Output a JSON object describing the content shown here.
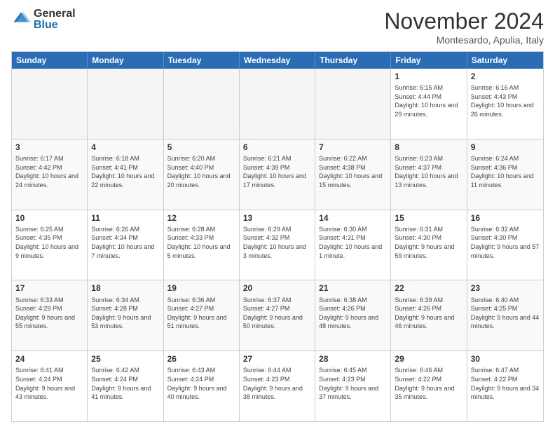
{
  "logo": {
    "general": "General",
    "blue": "Blue"
  },
  "title": "November 2024",
  "location": "Montesardo, Apulia, Italy",
  "days_of_week": [
    "Sunday",
    "Monday",
    "Tuesday",
    "Wednesday",
    "Thursday",
    "Friday",
    "Saturday"
  ],
  "weeks": [
    [
      {
        "day": "",
        "empty": true
      },
      {
        "day": "",
        "empty": true
      },
      {
        "day": "",
        "empty": true
      },
      {
        "day": "",
        "empty": true
      },
      {
        "day": "",
        "empty": true
      },
      {
        "day": "1",
        "sunrise": "Sunrise: 6:15 AM",
        "sunset": "Sunset: 4:44 PM",
        "daylight": "Daylight: 10 hours and 29 minutes."
      },
      {
        "day": "2",
        "sunrise": "Sunrise: 6:16 AM",
        "sunset": "Sunset: 4:43 PM",
        "daylight": "Daylight: 10 hours and 26 minutes."
      }
    ],
    [
      {
        "day": "3",
        "sunrise": "Sunrise: 6:17 AM",
        "sunset": "Sunset: 4:42 PM",
        "daylight": "Daylight: 10 hours and 24 minutes."
      },
      {
        "day": "4",
        "sunrise": "Sunrise: 6:18 AM",
        "sunset": "Sunset: 4:41 PM",
        "daylight": "Daylight: 10 hours and 22 minutes."
      },
      {
        "day": "5",
        "sunrise": "Sunrise: 6:20 AM",
        "sunset": "Sunset: 4:40 PM",
        "daylight": "Daylight: 10 hours and 20 minutes."
      },
      {
        "day": "6",
        "sunrise": "Sunrise: 6:21 AM",
        "sunset": "Sunset: 4:39 PM",
        "daylight": "Daylight: 10 hours and 17 minutes."
      },
      {
        "day": "7",
        "sunrise": "Sunrise: 6:22 AM",
        "sunset": "Sunset: 4:38 PM",
        "daylight": "Daylight: 10 hours and 15 minutes."
      },
      {
        "day": "8",
        "sunrise": "Sunrise: 6:23 AM",
        "sunset": "Sunset: 4:37 PM",
        "daylight": "Daylight: 10 hours and 13 minutes."
      },
      {
        "day": "9",
        "sunrise": "Sunrise: 6:24 AM",
        "sunset": "Sunset: 4:36 PM",
        "daylight": "Daylight: 10 hours and 11 minutes."
      }
    ],
    [
      {
        "day": "10",
        "sunrise": "Sunrise: 6:25 AM",
        "sunset": "Sunset: 4:35 PM",
        "daylight": "Daylight: 10 hours and 9 minutes."
      },
      {
        "day": "11",
        "sunrise": "Sunrise: 6:26 AM",
        "sunset": "Sunset: 4:34 PM",
        "daylight": "Daylight: 10 hours and 7 minutes."
      },
      {
        "day": "12",
        "sunrise": "Sunrise: 6:28 AM",
        "sunset": "Sunset: 4:33 PM",
        "daylight": "Daylight: 10 hours and 5 minutes."
      },
      {
        "day": "13",
        "sunrise": "Sunrise: 6:29 AM",
        "sunset": "Sunset: 4:32 PM",
        "daylight": "Daylight: 10 hours and 3 minutes."
      },
      {
        "day": "14",
        "sunrise": "Sunrise: 6:30 AM",
        "sunset": "Sunset: 4:31 PM",
        "daylight": "Daylight: 10 hours and 1 minute."
      },
      {
        "day": "15",
        "sunrise": "Sunrise: 6:31 AM",
        "sunset": "Sunset: 4:30 PM",
        "daylight": "Daylight: 9 hours and 59 minutes."
      },
      {
        "day": "16",
        "sunrise": "Sunrise: 6:32 AM",
        "sunset": "Sunset: 4:30 PM",
        "daylight": "Daylight: 9 hours and 57 minutes."
      }
    ],
    [
      {
        "day": "17",
        "sunrise": "Sunrise: 6:33 AM",
        "sunset": "Sunset: 4:29 PM",
        "daylight": "Daylight: 9 hours and 55 minutes."
      },
      {
        "day": "18",
        "sunrise": "Sunrise: 6:34 AM",
        "sunset": "Sunset: 4:28 PM",
        "daylight": "Daylight: 9 hours and 53 minutes."
      },
      {
        "day": "19",
        "sunrise": "Sunrise: 6:36 AM",
        "sunset": "Sunset: 4:27 PM",
        "daylight": "Daylight: 9 hours and 51 minutes."
      },
      {
        "day": "20",
        "sunrise": "Sunrise: 6:37 AM",
        "sunset": "Sunset: 4:27 PM",
        "daylight": "Daylight: 9 hours and 50 minutes."
      },
      {
        "day": "21",
        "sunrise": "Sunrise: 6:38 AM",
        "sunset": "Sunset: 4:26 PM",
        "daylight": "Daylight: 9 hours and 48 minutes."
      },
      {
        "day": "22",
        "sunrise": "Sunrise: 6:39 AM",
        "sunset": "Sunset: 4:26 PM",
        "daylight": "Daylight: 9 hours and 46 minutes."
      },
      {
        "day": "23",
        "sunrise": "Sunrise: 6:40 AM",
        "sunset": "Sunset: 4:25 PM",
        "daylight": "Daylight: 9 hours and 44 minutes."
      }
    ],
    [
      {
        "day": "24",
        "sunrise": "Sunrise: 6:41 AM",
        "sunset": "Sunset: 4:24 PM",
        "daylight": "Daylight: 9 hours and 43 minutes."
      },
      {
        "day": "25",
        "sunrise": "Sunrise: 6:42 AM",
        "sunset": "Sunset: 4:24 PM",
        "daylight": "Daylight: 9 hours and 41 minutes."
      },
      {
        "day": "26",
        "sunrise": "Sunrise: 6:43 AM",
        "sunset": "Sunset: 4:24 PM",
        "daylight": "Daylight: 9 hours and 40 minutes."
      },
      {
        "day": "27",
        "sunrise": "Sunrise: 6:44 AM",
        "sunset": "Sunset: 4:23 PM",
        "daylight": "Daylight: 9 hours and 38 minutes."
      },
      {
        "day": "28",
        "sunrise": "Sunrise: 6:45 AM",
        "sunset": "Sunset: 4:23 PM",
        "daylight": "Daylight: 9 hours and 37 minutes."
      },
      {
        "day": "29",
        "sunrise": "Sunrise: 6:46 AM",
        "sunset": "Sunset: 4:22 PM",
        "daylight": "Daylight: 9 hours and 35 minutes."
      },
      {
        "day": "30",
        "sunrise": "Sunrise: 6:47 AM",
        "sunset": "Sunset: 4:22 PM",
        "daylight": "Daylight: 9 hours and 34 minutes."
      }
    ]
  ]
}
